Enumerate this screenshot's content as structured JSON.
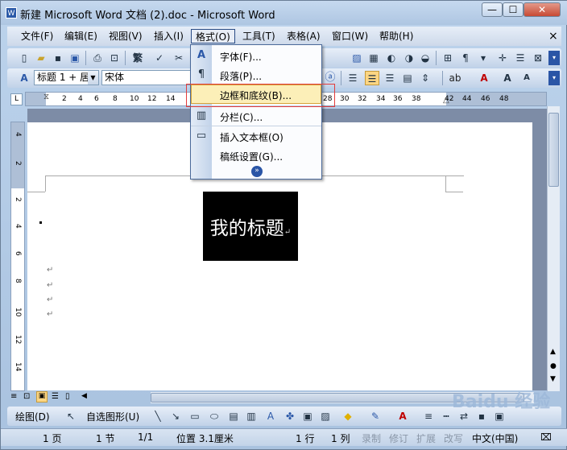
{
  "window": {
    "title": "新建 Microsoft Word 文档 (2).doc - Microsoft Word",
    "min": "—",
    "max": "☐",
    "close": "✕"
  },
  "menubar": [
    {
      "label": "文件(F)"
    },
    {
      "label": "编辑(E)"
    },
    {
      "label": "视图(V)"
    },
    {
      "label": "插入(I)"
    },
    {
      "label": "格式(O)"
    },
    {
      "label": "工具(T)"
    },
    {
      "label": "表格(A)"
    },
    {
      "label": "窗口(W)"
    },
    {
      "label": "帮助(H)"
    }
  ],
  "menubar_close": "×",
  "format_menu": {
    "items": [
      {
        "label": "字体(F)...",
        "icon": "A"
      },
      {
        "label": "段落(P)...",
        "icon": "¶"
      },
      {
        "label": "边框和底纹(B)...",
        "icon": ""
      },
      {
        "label": "分栏(C)...",
        "icon": "▥"
      },
      {
        "label": "插入文本框(O)",
        "icon": "▭"
      },
      {
        "label": "稿纸设置(G)...",
        "icon": ""
      }
    ],
    "expand": "»"
  },
  "formatting": {
    "style": "标题 1 + 居",
    "font": "宋体"
  },
  "ruler": {
    "numbers": [
      "2",
      "4",
      "6",
      "8",
      "10",
      "12",
      "14",
      "28",
      "30",
      "32",
      "34",
      "36",
      "38",
      "42",
      "44",
      "46",
      "48"
    ]
  },
  "vruler": {
    "numbers": [
      "4",
      "2",
      "2",
      "4",
      "6",
      "8",
      "10",
      "12",
      "14"
    ]
  },
  "document": {
    "heading": "我的标题",
    "para_mark": "↵"
  },
  "drawbar": {
    "draw": "绘图(D)",
    "autoshapes": "自选图形(U)"
  },
  "status": {
    "page": "1 页",
    "section": "1 节",
    "pages": "1/1",
    "position": "位置 3.1厘米",
    "line": "1 行",
    "column": "1 列",
    "rec": "录制",
    "trk": "修订",
    "ext": "扩展",
    "ovr": "改写",
    "lang": "中文(中国)"
  },
  "watermark": "Baidu 经验",
  "colors": {
    "highlight": "#fcefb8",
    "accent_red": "#e23c3c",
    "font_color": "#c00000"
  }
}
